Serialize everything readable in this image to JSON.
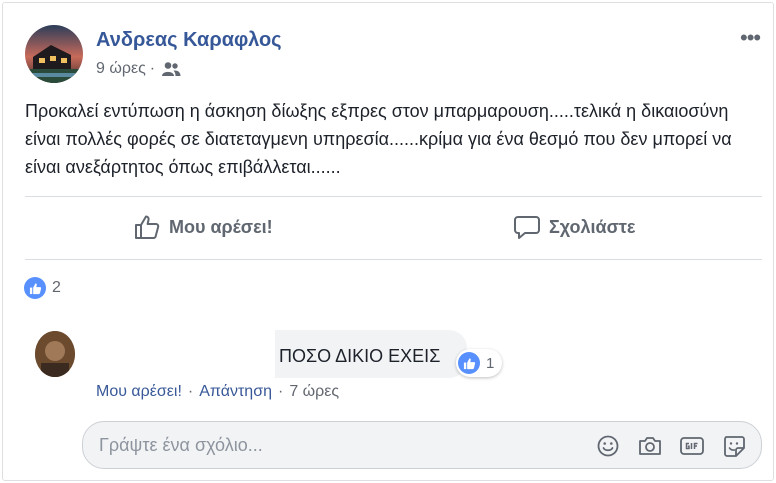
{
  "post": {
    "author": "Ανδρεας Καραφλος",
    "time": "9 ώρες",
    "separator": "·",
    "privacy_icon": "friends-icon",
    "more_label": "•••",
    "text": "Προκαλεί εντύπωση η άσκηση δίωξης εξπρες στον μπαρμαρουση.....τελικά η δικαιοσύνη είναι πολλές φορές σε διατεταγμενη υπηρεσία......κρίμα για ένα θεσμό που δεν μπορεί να είναι ανεξάρτητος όπως επιβάλλεται......"
  },
  "actions": {
    "like_label": "Μου αρέσει!",
    "comment_label": "Σχολιάστε"
  },
  "reactions": {
    "count": "2"
  },
  "comment": {
    "text": "ΠΟΣΟ ΔΙΚΙΟ ΕΧΕΙΣ",
    "reaction_count": "1",
    "like_label": "Μου αρέσει!",
    "dot1": "·",
    "reply_label": "Απάντηση",
    "dot2": "·",
    "time": "7 ώρες"
  },
  "composer": {
    "placeholder": "Γράψτε ένα σχόλιο...",
    "icons": [
      "emoji-icon",
      "camera-icon",
      "gif-icon",
      "sticker-icon"
    ]
  },
  "colors": {
    "link": "#365899",
    "like_blue": "#5890ff",
    "muted": "#616770"
  }
}
